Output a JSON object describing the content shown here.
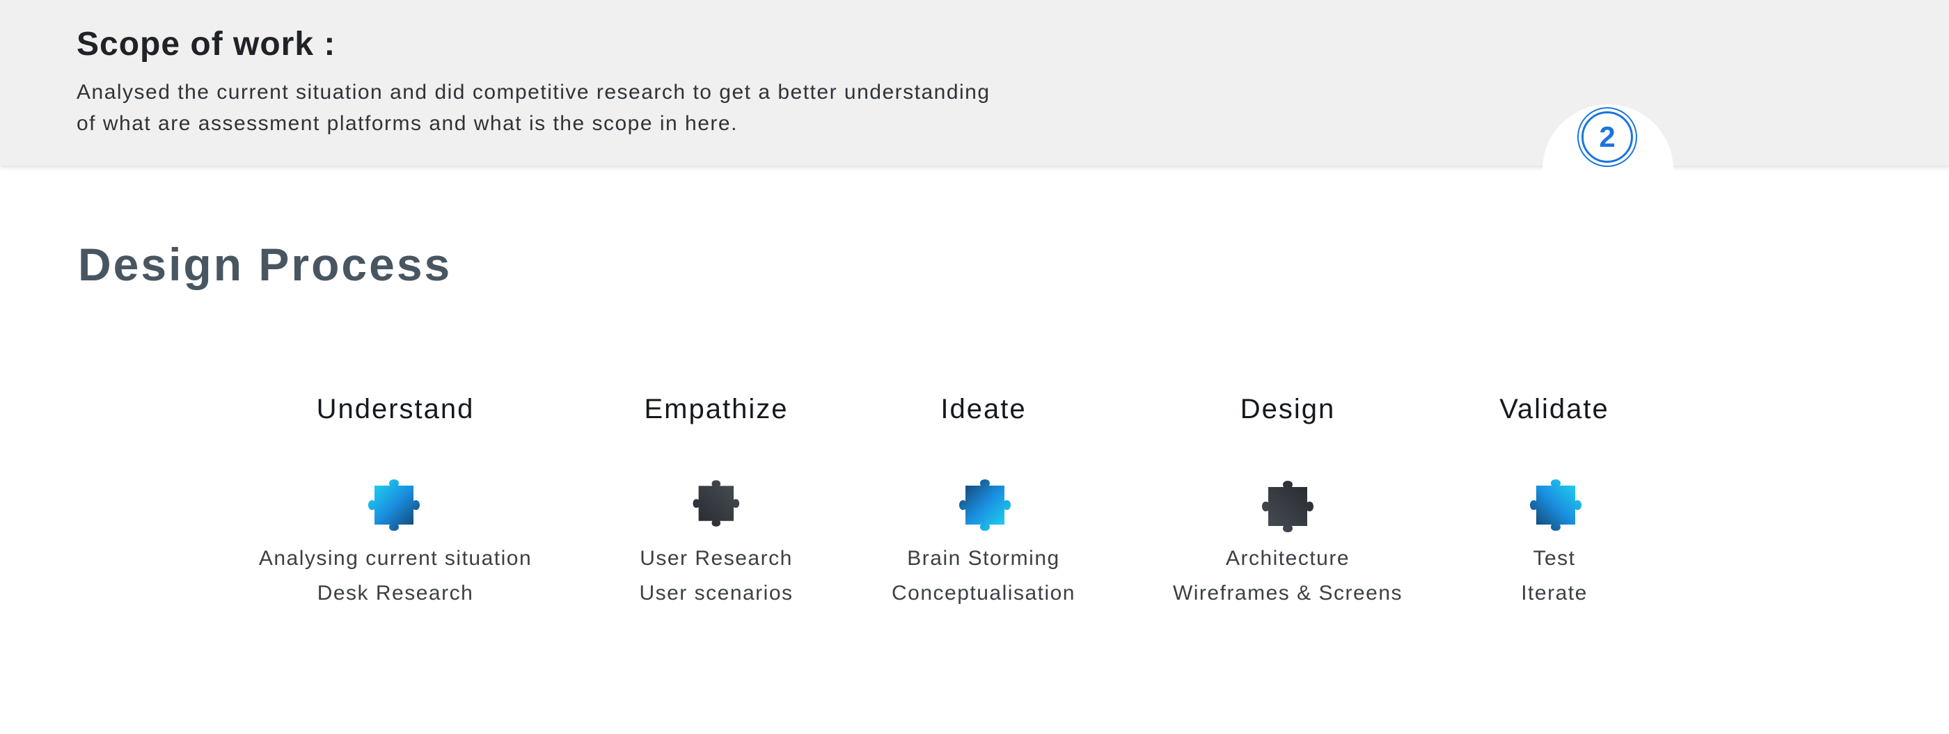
{
  "header": {
    "title": "Scope of work :",
    "description_line1": "Analysed the current situation and did competitive research to get a better understanding",
    "description_line2": "of what are assessment platforms and what is the scope in here.",
    "page_number": "2",
    "accent_color": "#1b75e0"
  },
  "section": {
    "title": "Design Process"
  },
  "steps": [
    {
      "title": "Understand",
      "icon": "puzzle-piece-icon",
      "color": "cyan-blue",
      "items": [
        "Analysing current situation",
        "Desk Research"
      ]
    },
    {
      "title": "Empathize",
      "icon": "puzzle-piece-icon",
      "color": "dark-gray",
      "items": [
        "User Research",
        "User scenarios"
      ]
    },
    {
      "title": "Ideate",
      "icon": "puzzle-piece-icon",
      "color": "cyan-blue",
      "items": [
        "Brain Storming",
        "Conceptualisation"
      ]
    },
    {
      "title": "Design",
      "icon": "puzzle-piece-icon",
      "color": "dark-gray",
      "items": [
        "Architecture",
        "Wireframes & Screens"
      ]
    },
    {
      "title": "Validate",
      "icon": "puzzle-piece-icon",
      "color": "cyan-blue",
      "items": [
        "Test",
        "Iterate"
      ]
    }
  ]
}
